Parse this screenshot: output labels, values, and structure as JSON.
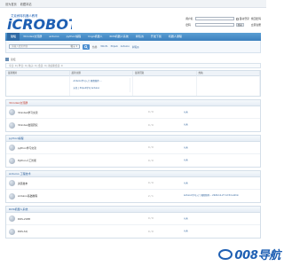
{
  "topbar": {
    "links": [
      "设为首页",
      "收藏本站"
    ]
  },
  "login": {
    "user_label": "用户名",
    "pass_label": "密码",
    "auto_login": "自动登录",
    "remember": "找回密码",
    "login_btn": "登录",
    "register": "立即注册",
    "qq_login": "注册后加群机器人"
  },
  "nav": {
    "items": [
      "论坛",
      "3Cindex交流群",
      "arduino",
      "python编程",
      "lingo机器人",
      "ROS机器人系统",
      "树莓派",
      "开发下载",
      "机器人课程"
    ]
  },
  "search": {
    "placeholder": "请输入搜索内容",
    "type": "帖子",
    "hot_label": "热搜:",
    "hot": [
      "3Cinfo",
      "3Cpub",
      "Arduino",
      "树莓派"
    ]
  },
  "crumb": {
    "home": "论坛"
  },
  "notice": {
    "text": "今日: 0 | 昨日: 0 | 帖子: 0 | 会员: 0 | 欢迎新会员: 0"
  },
  "stats": {
    "headers": [
      "最新图片",
      "最新主题",
      "最新回复",
      "热帖"
    ],
    "topics": [
      "Arduino学习入门 教程推荐 ...",
      "水色 | 3Cpub学习 Arduino"
    ]
  },
  "categories": [
    {
      "title": "3Cindex交流群",
      "red": true,
      "forums": [
        {
          "name": "3Cindex学习交流",
          "count": "0 / 0",
          "last": "从未"
        },
        {
          "name": "3Cindex发展研究",
          "count": "0 / 0",
          "last": "从未"
        }
      ]
    },
    {
      "title": "python编程",
      "red": false,
      "forums": [
        {
          "name": "python学习交流",
          "count": "0 / 0",
          "last": "从未"
        },
        {
          "name": "Python人工智能",
          "count": "0 / 0",
          "last": "从未"
        }
      ]
    },
    {
      "title": "Arduino 工程技术",
      "red": false,
      "forums": [
        {
          "name": "资源发布",
          "count": "0 / 0",
          "last": "从未"
        },
        {
          "name": "Arduino基础教程",
          "count": "2 / 1",
          "last": "Arduino学习入门 教程推荐... 2020-12-27 12:54 admin"
        }
      ]
    },
    {
      "title": "ROS机器人系统",
      "red": false,
      "forums": [
        {
          "name": "ROS-2188",
          "count": "0 / 0",
          "last": "从未"
        },
        {
          "name": "ROS-SQ",
          "count": "0 / 0",
          "last": "从未"
        }
      ]
    }
  ],
  "watermark": {
    "text": "008导航"
  }
}
